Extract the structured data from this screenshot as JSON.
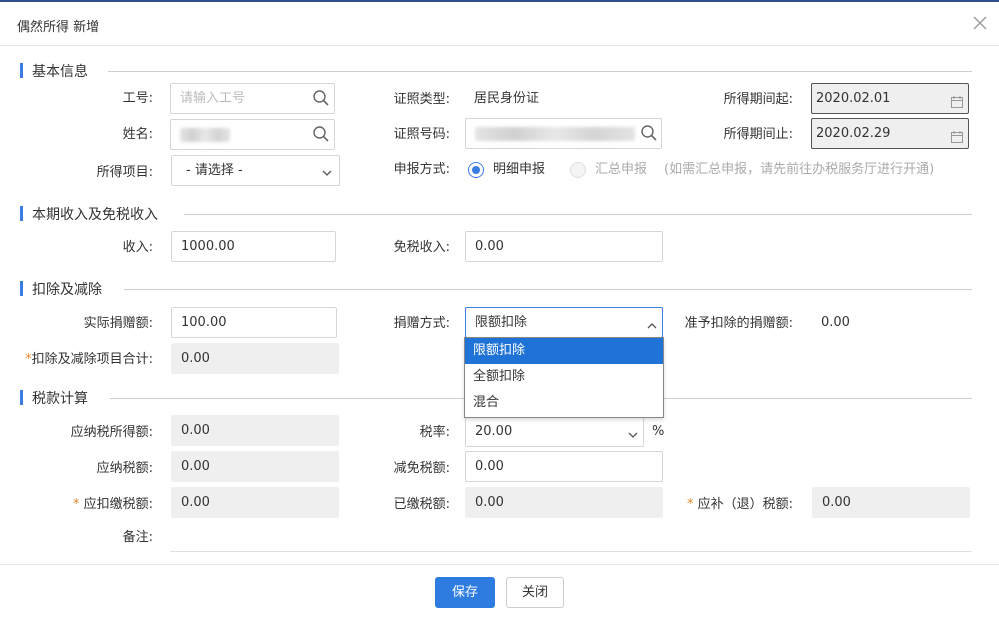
{
  "dialog": {
    "title": "偶然所得 新增"
  },
  "sections": {
    "basic": "基本信息",
    "income": "本期收入及免税收入",
    "deduction": "扣除及减除",
    "tax": "税款计算"
  },
  "basic": {
    "emp_no_label": "工号:",
    "emp_no_placeholder": "请输入工号",
    "name_label": "姓名:",
    "item_label": "所得项目:",
    "item_value": "- 请选择 -",
    "id_type_label": "证照类型:",
    "id_type_value": "居民身份证",
    "id_no_label": "证照号码:",
    "declare_label": "申报方式:",
    "declare_opt1": "明细申报",
    "declare_opt2": "汇总申报",
    "declare_hint": "(如需汇总申报，请先前往办税服务厅进行开通)",
    "period_start_label": "所得期间起:",
    "period_start_value": "2020.02.01",
    "period_end_label": "所得期间止:",
    "period_end_value": "2020.02.29"
  },
  "income": {
    "income_label": "收入:",
    "income_value": "1000.00",
    "exempt_label": "免税收入:",
    "exempt_value": "0.00"
  },
  "deduction": {
    "donation_label": "实际捐赠额:",
    "donation_value": "100.00",
    "method_label": "捐赠方式:",
    "method_value": "限额扣除",
    "allowed_label": "准予扣除的捐赠额:",
    "allowed_value": "0.00",
    "total_label": "扣除及减除项目合计:",
    "total_value": "0.00",
    "options": [
      "限额扣除",
      "全额扣除",
      "混合"
    ]
  },
  "tax": {
    "taxable_label": "应纳税所得额:",
    "taxable_value": "0.00",
    "rate_label": "税率:",
    "rate_value": "20.00",
    "rate_unit": "%",
    "payable_label": "应纳税额:",
    "payable_value": "0.00",
    "relief_label": "减免税额:",
    "relief_value": "0.00",
    "withhold_label": "应扣缴税额:",
    "withhold_value": "0.00",
    "paid_label": "已缴税额:",
    "paid_value": "0.00",
    "refund_label": "应补（退）税额:",
    "refund_value": "0.00",
    "remark_label": "备注:"
  },
  "footer": {
    "save": "保存",
    "close": "关闭"
  },
  "colors": {
    "accent": "#3b7de0",
    "required": "#e8892b",
    "selected": "#1f73d6"
  }
}
